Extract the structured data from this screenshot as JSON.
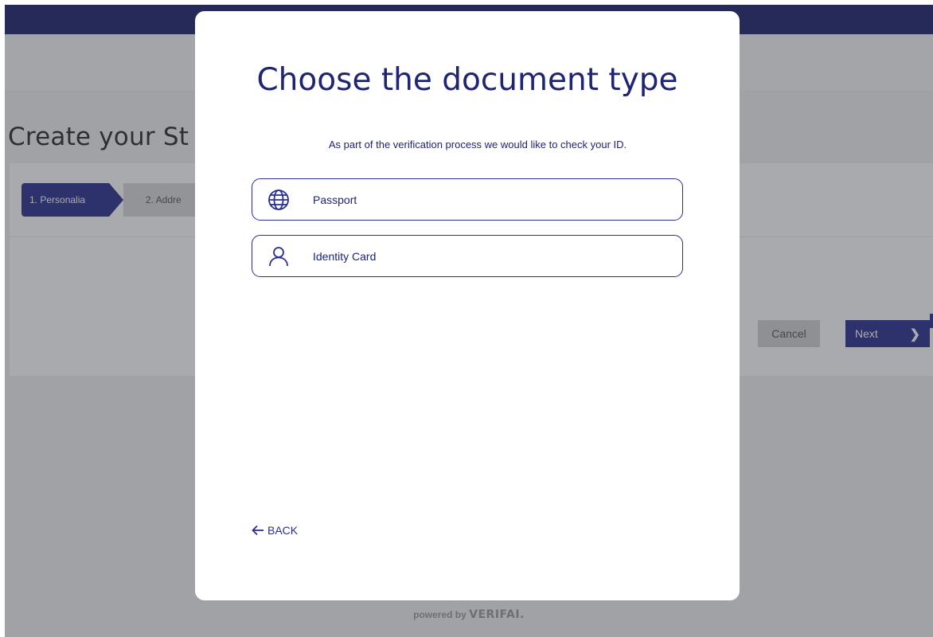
{
  "background": {
    "page_title": "Create your St",
    "steps": [
      {
        "label": "1. Personalia"
      },
      {
        "label": "2. Addre"
      }
    ],
    "cancel_label": "Cancel",
    "next_label": "Next",
    "powered_by": "powered by",
    "brand": "VERIFAI."
  },
  "modal": {
    "title": "Choose the document type",
    "subtitle": "As part of the verification process we would like to check your ID.",
    "options": [
      {
        "label": "Passport",
        "icon": "globe-icon"
      },
      {
        "label": "Identity Card",
        "icon": "user-icon"
      }
    ],
    "back_label": "BACK"
  },
  "colors": {
    "accent": "#2a2f8f",
    "topbar": "#1e246f",
    "text_primary": "#1f2473"
  }
}
